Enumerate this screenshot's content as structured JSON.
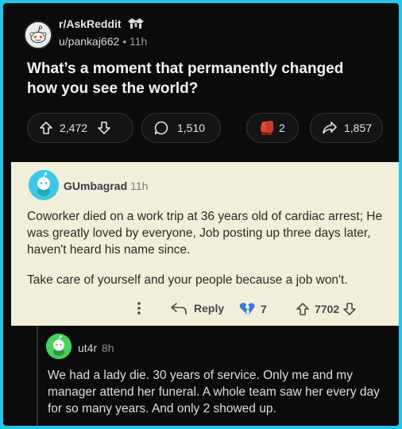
{
  "post": {
    "subreddit": "r/AskReddit",
    "author": "u/pankaj662",
    "separator": "•",
    "age": "11h",
    "title": "What’s a moment that permanently changed how you see the world?",
    "upvotes": "2,472",
    "comments": "1,510",
    "awards": "2",
    "shares": "1,857"
  },
  "comment": {
    "author": "GUmbagrad",
    "age": "11h",
    "paragraphs": [
      "Coworker died on a work trip at 36 years old of cardiac arrest; He was greatly loved by everyone, Job posting up three days later, haven't heard his name since.",
      "Take care of yourself and your people because a job won't."
    ],
    "reply_label": "Reply",
    "awards": "7",
    "votes": "7702"
  },
  "reply": {
    "author": "ut4r",
    "age": "8h",
    "body": "We had a lady die. 30 years of service. Only me and my manager attend her funeral. A whole team saw her every day for so many years. And only 2 showed up."
  },
  "colors": {
    "frame_border": "#27c4ea",
    "background": "#0b0b0b",
    "highlight_background": "#f2eedc",
    "commenter_avatar": "#3dc9e6",
    "reply_avatar": "#46d160",
    "award_red": "#e0483c",
    "broken_heart_blue": "#3a7bd5"
  },
  "icons": [
    "reddit-snoo-avatar-icon",
    "award-icon",
    "upvote-arrow-icon",
    "downvote-arrow-icon",
    "comment-bubble-icon",
    "boxing-glove-award-icon",
    "share-arrow-icon",
    "more-dots-icon",
    "reply-arrow-icon",
    "broken-heart-award-icon"
  ]
}
